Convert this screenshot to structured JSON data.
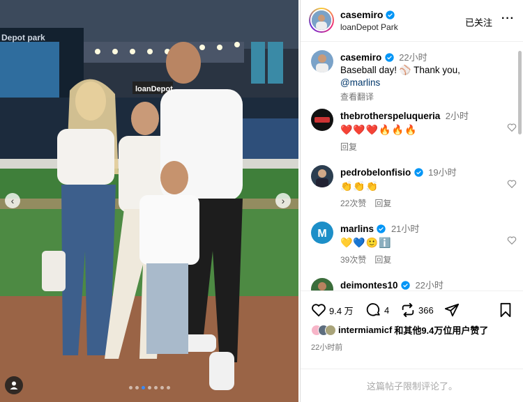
{
  "media": {
    "slide_count": 7,
    "active_slide": 2,
    "stadium_sign": "loanDepot",
    "stadium_wall_text": "Depot park",
    "prev_icon": "chevron-left-icon",
    "next_icon": "chevron-right-icon",
    "tag_icon": "user-tag-icon"
  },
  "header": {
    "username": "casemiro",
    "location": "loanDepot Park",
    "follow_status": "已关注",
    "more": "···"
  },
  "caption": {
    "username": "casemiro",
    "time": "22小时",
    "text_line1": "Baseball day! ⚾ Thank you,",
    "mention": "@marlins",
    "translate": "查看翻译"
  },
  "comments": [
    {
      "username": "thebrotherspeluqueria",
      "time": "2小时",
      "text": "❤️❤️❤️🔥🔥🔥",
      "likes": "",
      "reply": "回复",
      "verified": false
    },
    {
      "username": "pedrobelonfisio",
      "time": "19小时",
      "text": "👏👏👏",
      "likes": "22次赞",
      "reply": "回复",
      "verified": true
    },
    {
      "username": "marlins",
      "time": "21小时",
      "text": "💛💙🙂ℹ️",
      "likes": "39次赞",
      "reply": "回复",
      "verified": true
    },
    {
      "username": "deimontes10",
      "time": "22小时",
      "text": "",
      "likes": "",
      "reply": "",
      "verified": true
    }
  ],
  "actions": {
    "like_count": "9.4 万",
    "comment_count": "4",
    "repost_count": "366",
    "liked_by_user": "intermiamicf",
    "liked_by_rest": "和其他9.4万位用户赞了",
    "post_time": "22小时前",
    "comments_limited": "这篇帖子限制评论了。"
  },
  "colors": {
    "verified": "#0095f6",
    "link": "#00376b",
    "muted": "#737373",
    "active_dot": "#3a8bf7"
  }
}
